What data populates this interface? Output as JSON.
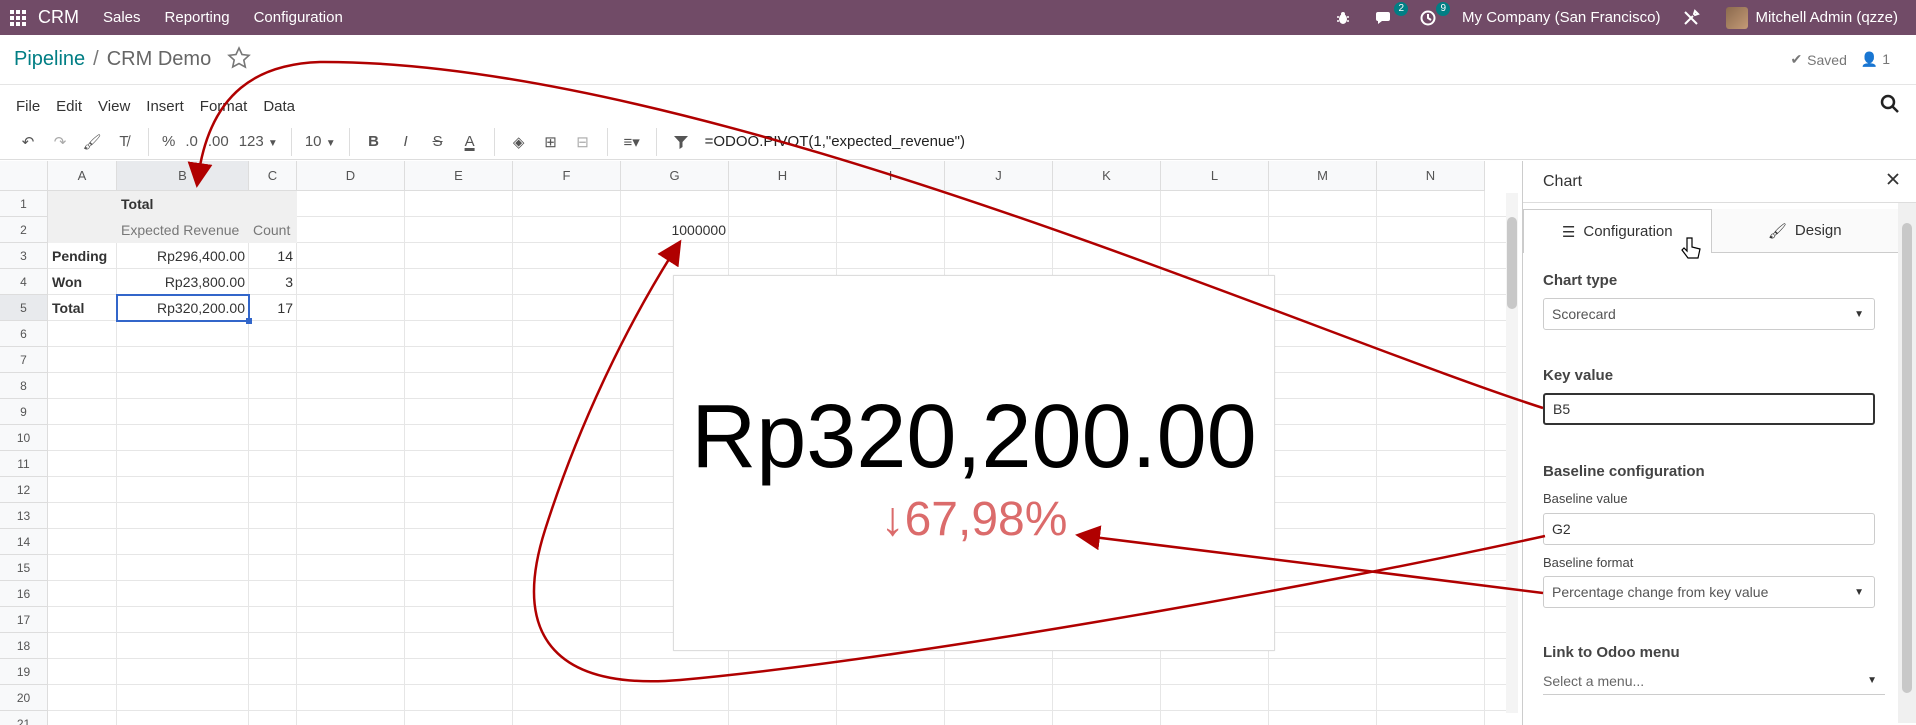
{
  "navbar": {
    "app_name": "CRM",
    "menu": [
      "Sales",
      "Reporting",
      "Configuration"
    ],
    "messages_count": "2",
    "activities_count": "9",
    "company": "My Company (San Francisco)",
    "user": "Mitchell Admin (qzze)"
  },
  "breadcrumb": {
    "parent": "Pipeline",
    "separator": "/",
    "current": "CRM Demo"
  },
  "status": {
    "saved": "Saved",
    "users": "1"
  },
  "menubar": [
    "File",
    "Edit",
    "View",
    "Insert",
    "Format",
    "Data"
  ],
  "toolbar": {
    "percent": "%",
    "dec_decrease": ".0",
    "dec_increase": ".00",
    "format": "123",
    "font_size": "10",
    "formula": "=ODOO.PIVOT(1,\"expected_revenue\")"
  },
  "grid": {
    "columns": [
      "A",
      "B",
      "C",
      "D",
      "E",
      "F",
      "G",
      "H",
      "I",
      "J",
      "K",
      "L",
      "M",
      "N"
    ],
    "rows": [
      "1",
      "2",
      "3",
      "4",
      "5",
      "6",
      "7",
      "8",
      "9",
      "10",
      "11",
      "12",
      "13",
      "14",
      "15",
      "16",
      "17",
      "18",
      "19",
      "20",
      "21"
    ],
    "cells": {
      "B1": "Total",
      "B2": "Expected Revenue",
      "C2": "Count",
      "G2": "1000000",
      "A3": "Pending",
      "B3": "Rp296,400.00",
      "C3": "14",
      "A4": "Won",
      "B4": "Rp23,800.00",
      "C4": "3",
      "A5": "Total",
      "B5": "Rp320,200.00",
      "C5": "17"
    }
  },
  "scorecard": {
    "key_value": "Rp320,200.00",
    "baseline": "↓67,98%",
    "baseline_color": "#DB6B6B"
  },
  "panel": {
    "title": "Chart",
    "tabs": [
      "Configuration",
      "Design"
    ],
    "chart_type_label": "Chart type",
    "chart_type": "Scorecard",
    "key_value_label": "Key value",
    "key_value": "B5",
    "baseline_section": "Baseline configuration",
    "baseline_value_label": "Baseline value",
    "baseline_value": "G2",
    "baseline_format_label": "Baseline format",
    "baseline_format": "Percentage change from key value",
    "link_label": "Link to Odoo menu",
    "link_placeholder": "Select a menu..."
  },
  "colors": {
    "brand": "#714B67",
    "accent": "#017E84",
    "selection": "#3266ca",
    "arrow": "#B00000"
  }
}
